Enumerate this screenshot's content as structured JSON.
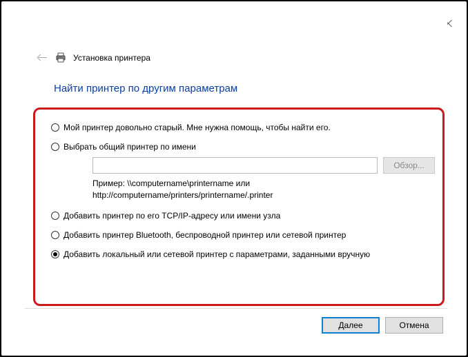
{
  "header": {
    "title": "Установка принтера"
  },
  "heading": "Найти принтер по другим параметрам",
  "options": {
    "old": {
      "label": "Мой принтер довольно старый. Мне нужна помощь, чтобы найти его.",
      "selected": false
    },
    "byname": {
      "label": "Выбрать общий принтер по имени",
      "selected": false,
      "value": "",
      "browse": "Обзор...",
      "example1": "Пример: \\\\computername\\printername или",
      "example2": "http://computername/printers/printername/.printer"
    },
    "tcpip": {
      "label": "Добавить принтер по его TCP/IP-адресу или имени узла",
      "selected": false
    },
    "bluetooth": {
      "label": "Добавить принтер Bluetooth, беспроводной принтер или сетевой принтер",
      "selected": false
    },
    "local": {
      "label": "Добавить локальный или сетевой принтер с параметрами, заданными вручную",
      "selected": true
    }
  },
  "footer": {
    "next": "Далее",
    "cancel": "Отмена"
  }
}
